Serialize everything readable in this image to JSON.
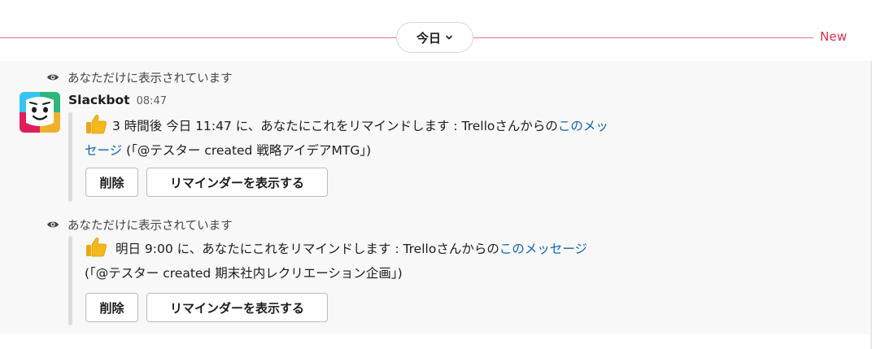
{
  "divider": {
    "date_label": "今日",
    "new_label": "New",
    "line_color": "#e07a8a",
    "new_color": "#d0314f"
  },
  "messages": [
    {
      "ephemeral_notice": "あなただけに表示されています",
      "sender": "Slackbot",
      "time": "08:47",
      "emoji": "thumbs-up-icon",
      "text_before": "3 時間後  今日 11:47  に、あなたにこれをリマインドします : Trelloさんからの",
      "link_line1": "このメッ",
      "link_line2": "セージ",
      "text_after": " (「@テスター created 戦略アイデアMTG」)",
      "buttons": {
        "delete": "削除",
        "show_reminders": "リマインダーを表示する"
      }
    },
    {
      "ephemeral_notice": "あなただけに表示されています",
      "emoji": "thumbs-up-icon",
      "text_before": "明日 9:00  に、あなたにこれをリマインドします : Trelloさんからの",
      "link": "このメッセージ",
      "text_after": "(「@テスター created 期末社内レクリエーション企画」)",
      "buttons": {
        "delete": "削除",
        "show_reminders": "リマインダーを表示する"
      }
    }
  ],
  "colors": {
    "link": "#1264a3",
    "message_bg": "#f8f8f8",
    "text": "#1d1c1d"
  }
}
